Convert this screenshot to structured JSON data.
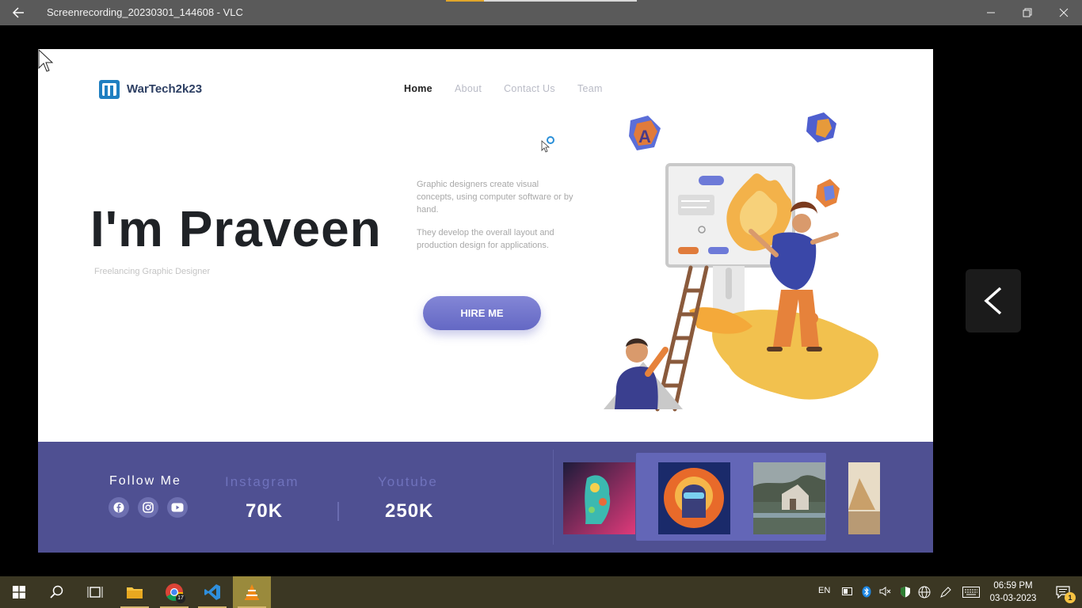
{
  "window": {
    "title": "Screenrecording_20230301_144608 - VLC"
  },
  "site": {
    "logo_text": "WarTech2k23",
    "nav": [
      {
        "label": "Home"
      },
      {
        "label": "About"
      },
      {
        "label": "Contact Us"
      },
      {
        "label": "Team"
      }
    ],
    "hero_name": "I'm Praveen",
    "hero_subtitle": "Freelancing Graphic Designer",
    "description_1": "Graphic designers create visual concepts, using computer software or by hand.",
    "description_2": "They develop the overall layout and production design for applications.",
    "hire_label": "HIRE ME",
    "follow_label": "Follow Me",
    "stats": [
      {
        "label": "Instagram",
        "value": "70K"
      },
      {
        "label": "Youtube",
        "value": "250K"
      }
    ],
    "social_icons": [
      "facebook-icon",
      "instagram-icon",
      "youtube-icon"
    ],
    "accent_color": "#4f5092"
  },
  "taskbar": {
    "language": "EN",
    "time": "06:59 PM",
    "date": "03-03-2023",
    "notification_count": "1",
    "chrome_badge": "17"
  }
}
